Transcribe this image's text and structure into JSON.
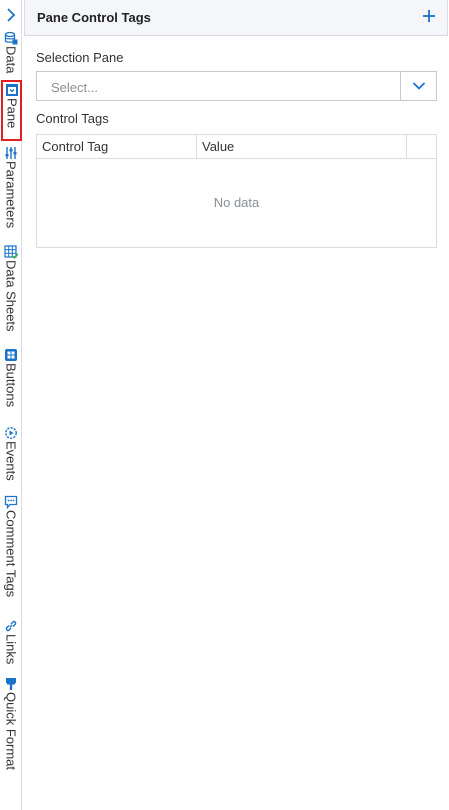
{
  "rail": {
    "toggle_icon": "chevron-right-icon",
    "tabs": [
      {
        "label": "Data",
        "icon": "database-icon"
      },
      {
        "label": "Pane",
        "icon": "pane-icon",
        "active": true
      },
      {
        "label": "Parameters",
        "icon": "sliders-icon"
      },
      {
        "label": "Data Sheets",
        "icon": "datasheet-icon"
      },
      {
        "label": "Buttons",
        "icon": "buttons-icon"
      },
      {
        "label": "Events",
        "icon": "events-icon"
      },
      {
        "label": "Comment Tags",
        "icon": "comment-icon"
      },
      {
        "label": "Links",
        "icon": "link-icon"
      },
      {
        "label": "Quick Format",
        "icon": "brush-icon"
      }
    ]
  },
  "header": {
    "title": "Pane Control Tags",
    "add_icon": "plus-icon"
  },
  "selection": {
    "label": "Selection Pane",
    "placeholder": "Select...",
    "dropdown_icon": "chevron-down-icon"
  },
  "control_tags": {
    "label": "Control Tags",
    "columns": [
      "Control Tag",
      "Value",
      ""
    ],
    "empty_text": "No data"
  },
  "colors": {
    "accent": "#1a73c8",
    "active_outline": "#e02020",
    "border": "#d9dde3",
    "header_bg": "#f4f6f9"
  }
}
